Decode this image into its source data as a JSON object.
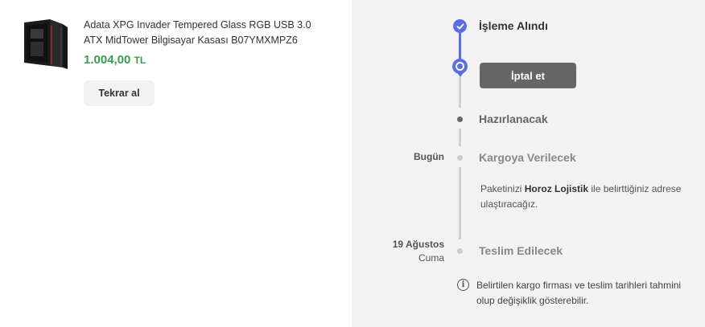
{
  "product": {
    "title": "Adata XPG Invader Tempered Glass RGB USB 3.0 ATX MidTower Bilgisayar Kasası B07YMXMPZ6",
    "price": "1.004,00",
    "currency": "TL",
    "image_icon": "pc-case-image",
    "rebuy_label": "Tekrar al"
  },
  "tracking": {
    "steps": [
      {
        "label": "İşleme Alındı",
        "state": "done"
      },
      {
        "label": "Hazırlanacak",
        "state": "upcoming"
      },
      {
        "label": "Kargoya Verilecek",
        "state": "pending",
        "date": "Bugün"
      },
      {
        "label": "Teslim Edilecek",
        "state": "pending",
        "date": "19 Ağustos",
        "day": "Cuma"
      }
    ],
    "cancel_label": "İptal et",
    "shipping_note_prefix": "Paketinizi",
    "carrier": "Horoz Lojistik",
    "shipping_note_suffix": "ile belirttiğiniz adrese ulaştıracağız.",
    "info_text": "Belirtilen kargo firması ve teslim tarihleri tahmini olup değişiklik gösterebilir."
  },
  "colors": {
    "accent": "#5b6ee1",
    "price": "#3a9d4a",
    "panel": "#f2f2f2",
    "cancel_button": "#666666"
  }
}
